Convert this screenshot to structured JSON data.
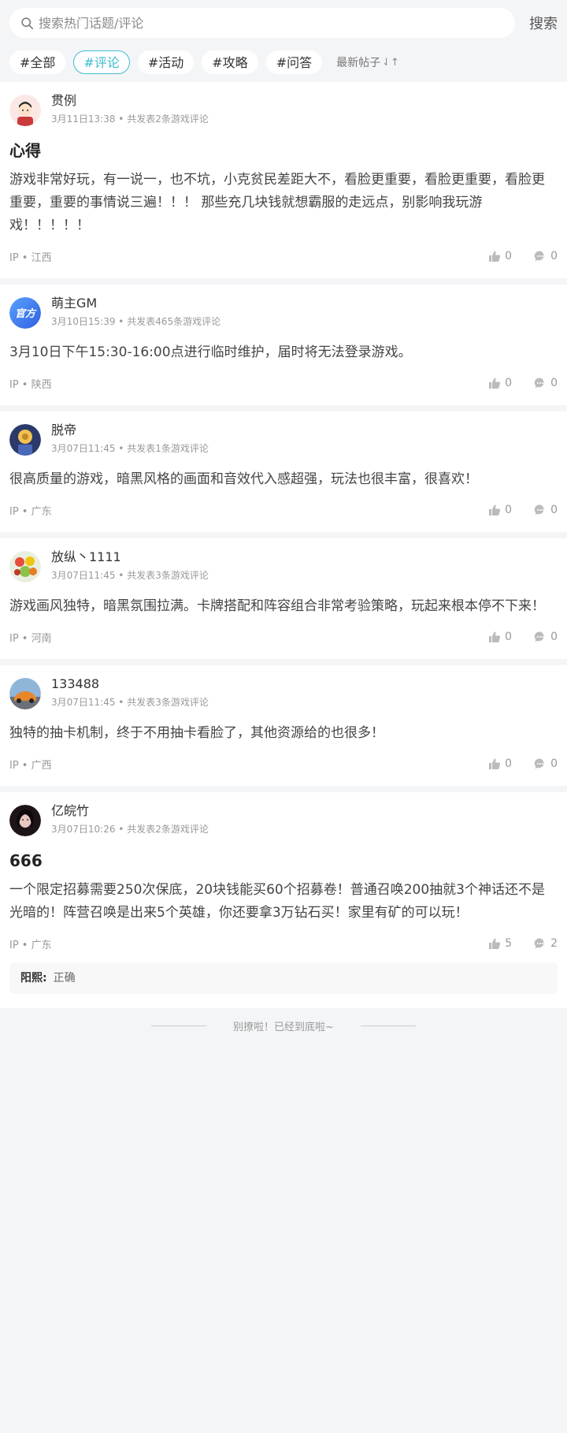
{
  "search": {
    "placeholder": "搜索热门话题/评论",
    "button": "搜索"
  },
  "tags": [
    "#全部",
    "#评论",
    "#活动",
    "#攻略",
    "#问答"
  ],
  "sort": {
    "label": "最新帖子",
    "icon": "⇃↑"
  },
  "posts": [
    {
      "username": "贯例",
      "meta": "3月11日13:38 • 共发表2条游戏评论",
      "title": "心得",
      "body": "游戏非常好玩，有一说一，也不坑，小克贫民差距大不，看脸更重要，看脸更重要，看脸更重要，重要的事情说三遍！！！ 那些充几块钱就想霸服的走远点，别影响我玩游戏！！！！！",
      "ip": "IP • 江西",
      "likes": "0",
      "comments": "0"
    },
    {
      "username": "萌主GM",
      "meta": "3月10日15:39 • 共发表465条游戏评论",
      "body": "3月10日下午15:30-16:00点进行临时维护，届时将无法登录游戏。",
      "ip": "IP • 陕西",
      "likes": "0",
      "comments": "0",
      "avatar_text": "官方"
    },
    {
      "username": "脱帝",
      "meta": "3月07日11:45 • 共发表1条游戏评论",
      "body": "很高质量的游戏，暗黑风格的画面和音效代入感超强，玩法也很丰富，很喜欢！",
      "ip": "IP • 广东",
      "likes": "0",
      "comments": "0"
    },
    {
      "username": "放纵丶1111",
      "meta": "3月07日11:45 • 共发表3条游戏评论",
      "body": "游戏画风独特，暗黑氛围拉满。卡牌搭配和阵容组合非常考验策略，玩起来根本停不下来！",
      "ip": "IP • 河南",
      "likes": "0",
      "comments": "0"
    },
    {
      "username": "133488",
      "meta": "3月07日11:45 • 共发表3条游戏评论",
      "body": "独特的抽卡机制，终于不用抽卡看脸了，其他资源给的也很多！",
      "ip": "IP • 广西",
      "likes": "0",
      "comments": "0"
    },
    {
      "username": "亿皖竹",
      "meta": "3月07日10:26 • 共发表2条游戏评论",
      "title": "666",
      "body": "一个限定招募需要250次保底，20块钱能买60个招募卷！普通召唤200抽就3个神话还不是光暗的！阵营召唤是出来5个英雄，你还要拿3万钻石买！家里有矿的可以玩！",
      "ip": "IP • 广东",
      "likes": "5",
      "comments": "2",
      "reply": {
        "author": "阳熙:",
        "text": "正确"
      }
    }
  ],
  "footer": {
    "end_text": "别撩啦！已经到底啦~"
  },
  "colors": {
    "accent": "#3dbcd0",
    "official_badge": "#3a7bf0"
  }
}
